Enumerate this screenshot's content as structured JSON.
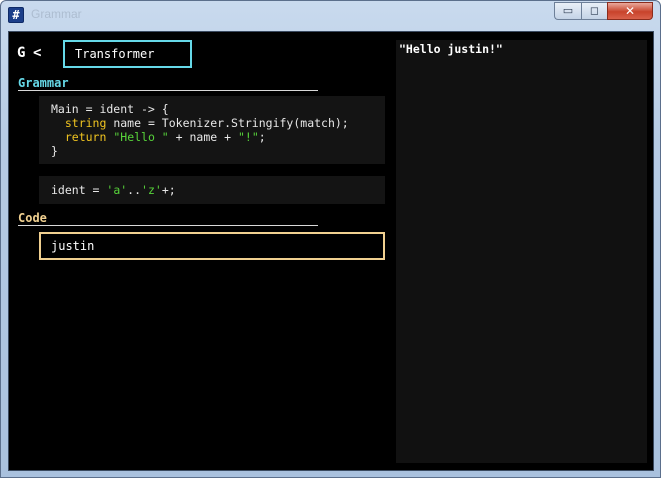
{
  "window": {
    "title": "Grammar",
    "icon_glyph": "#",
    "controls": {
      "minimize_glyph": "▭",
      "maximize_glyph": "◻",
      "close_glyph": "✕"
    }
  },
  "toolbar": {
    "g_label": "G",
    "back_label": "<",
    "name_value": "Transformer"
  },
  "grammar": {
    "heading": "Grammar",
    "heading_color": "#66d9e8",
    "rule1": {
      "l1": "Main = ident -> {",
      "l2_indent": "  ",
      "l2_kw": "string",
      "l2_rest": " name = Tokenizer.Stringify(match);",
      "l3_indent": "  ",
      "l3_kw": "return",
      "l3_sp": " ",
      "l3_str1": "\"Hello \"",
      "l3_mid": " + name + ",
      "l3_str2": "\"!\"",
      "l3_end": ";",
      "l4": "}"
    },
    "rule2": {
      "pre": "ident = ",
      "s1": "'a'",
      "mid": "..",
      "s2": "'z'",
      "post": "+;"
    }
  },
  "code": {
    "heading": "Code",
    "heading_color": "#f0d090",
    "input_value": "justin"
  },
  "output": {
    "text": "\"Hello justin!\""
  }
}
